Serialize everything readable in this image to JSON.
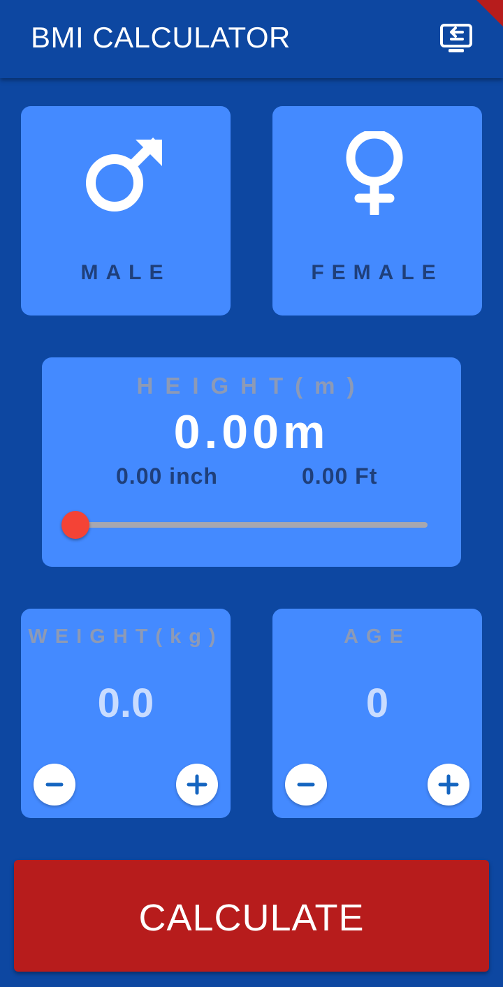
{
  "appbar": {
    "title": "BMI CALCULATOR",
    "action_icon": "screen-share-icon"
  },
  "gender": {
    "male": {
      "label": "MALE",
      "icon": "male-symbol-icon"
    },
    "female": {
      "label": "FEMALE",
      "icon": "female-symbol-icon"
    }
  },
  "height": {
    "label": "HEIGHT(m)",
    "value": "0.00m",
    "inch": "0.00 inch",
    "feet": "0.00 Ft",
    "slider_fraction": 0
  },
  "weight": {
    "label": "WEIGHT(kg)",
    "value": "0.0",
    "decrement_icon": "minus-icon",
    "increment_icon": "plus-icon"
  },
  "age": {
    "label": "AGE",
    "value": "0",
    "decrement_icon": "minus-icon",
    "increment_icon": "plus-icon"
  },
  "calculate": {
    "label": "CALCULATE"
  },
  "colors": {
    "background": "#0d47a1",
    "card": "#448aff",
    "calculate_button": "#b71c1c",
    "slider_thumb": "#f44336"
  }
}
